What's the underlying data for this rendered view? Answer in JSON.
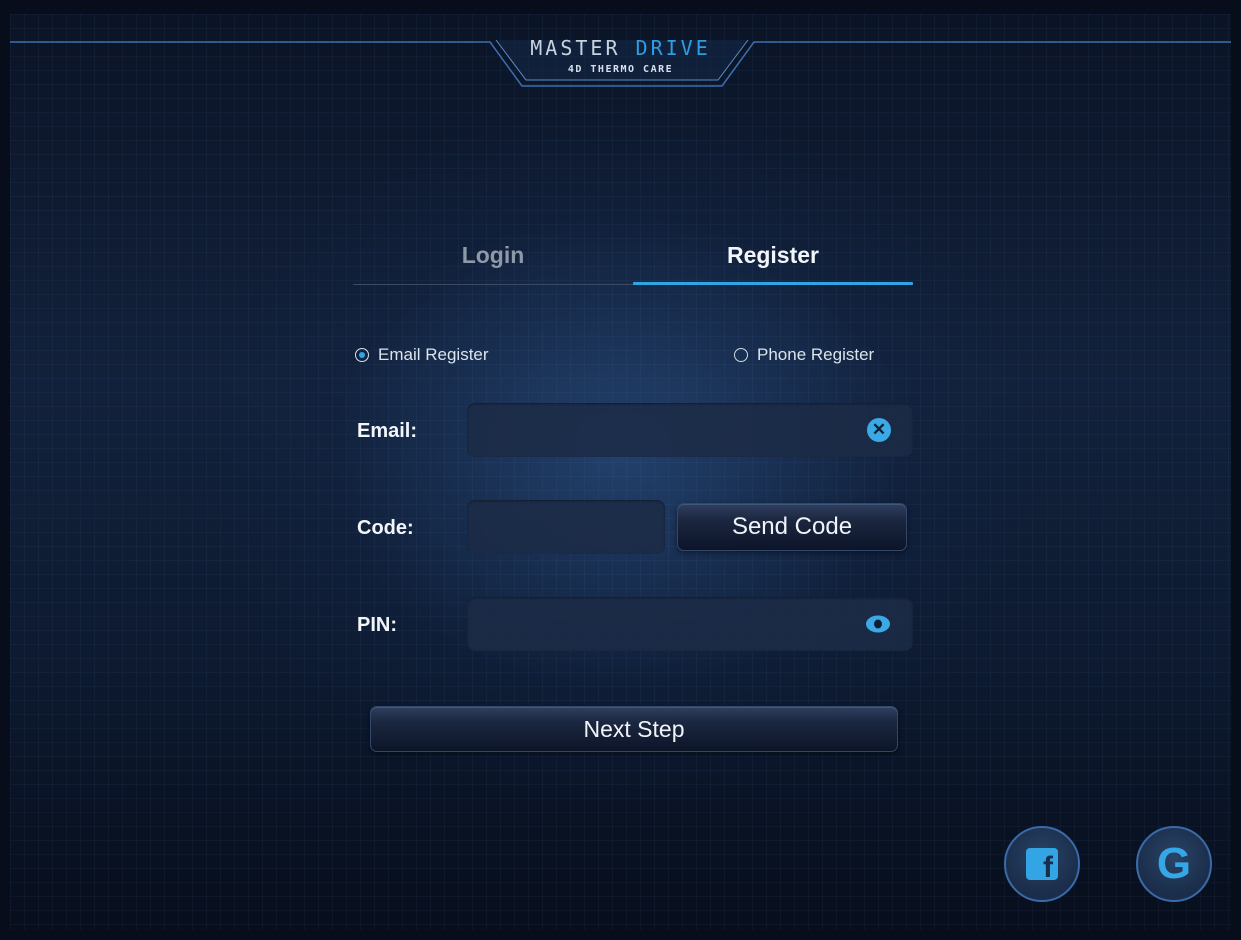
{
  "header": {
    "brand_main": "MASTER",
    "brand_accent": "DRIVE",
    "brand_sub": "4D THERMO CARE"
  },
  "tabs": [
    {
      "label": "Login",
      "active": false
    },
    {
      "label": "Register",
      "active": true
    }
  ],
  "register_type": {
    "options": [
      {
        "label": "Email Register",
        "selected": true
      },
      {
        "label": "Phone Register",
        "selected": false
      }
    ]
  },
  "form": {
    "email": {
      "label": "Email:",
      "value": "",
      "placeholder": ""
    },
    "code": {
      "label": "Code:",
      "value": "",
      "placeholder": ""
    },
    "pin": {
      "label": "PIN:",
      "value": "",
      "placeholder": ""
    },
    "send_code_label": "Send Code",
    "next_step_label": "Next Step"
  },
  "social": {
    "facebook_icon": "facebook-icon",
    "google_icon": "google-icon"
  },
  "colors": {
    "accent": "#2ea6e6",
    "background": "#0b1426"
  }
}
